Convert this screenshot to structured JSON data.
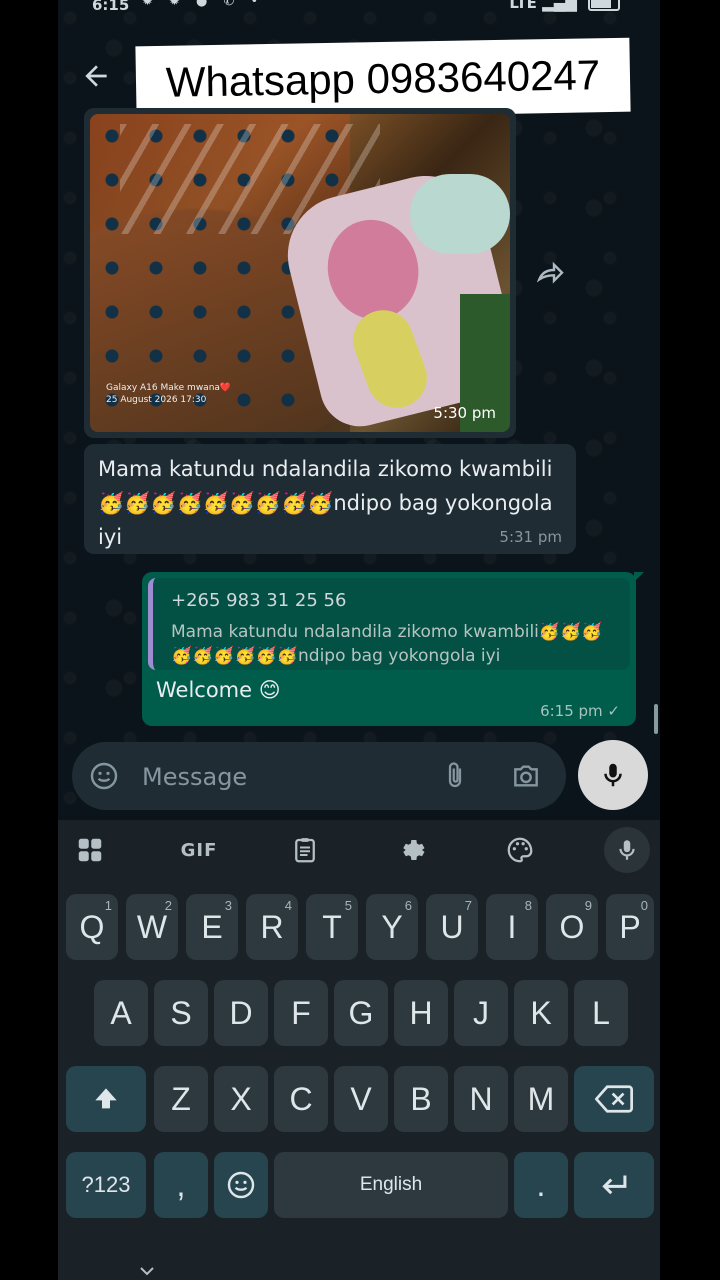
{
  "status_bar": {
    "time": "6:15",
    "notification_icons": "✹ ✹ ● ✆ •",
    "network": "LTE",
    "battery_icon": "battery-charging-icon"
  },
  "header": {
    "back_icon": "arrow-left-icon",
    "overlay_caption": "Whatsapp 0983640247"
  },
  "messages": [
    {
      "type": "image",
      "direction": "incoming",
      "watermark_line1": "Galaxy A16 Make mwana❤️",
      "watermark_line2": "25 August 2026 17:30",
      "time": "5:30 pm",
      "forward_icon": "forward-icon"
    },
    {
      "type": "text",
      "direction": "incoming",
      "text": "Mama katundu ndalandila zikomo kwambili🥳🥳🥳🥳🥳🥳🥳🥳🥳ndipo bag yokongola iyi",
      "time": "5:31 pm"
    },
    {
      "type": "reply",
      "direction": "outgoing",
      "quote_author": "+265 983 31 25 56",
      "quote_text": "Mama katundu ndalandila zikomo kwambili🥳🥳🥳🥳🥳🥳🥳🥳🥳ndipo bag yokongola iyi",
      "text": "Welcome 😊",
      "time": "6:15 pm ✓"
    }
  ],
  "composer": {
    "placeholder": "Message",
    "emoji_icon": "sticker-icon",
    "attach_icon": "paperclip-icon",
    "camera_icon": "camera-icon",
    "mic_icon": "microphone-icon"
  },
  "keyboard": {
    "toolbar": {
      "apps_icon": "grid-icon",
      "gif_label": "GIF",
      "clipboard_icon": "clipboard-icon",
      "settings_icon": "gear-icon",
      "theme_icon": "palette-icon",
      "voice_icon": "microphone-icon"
    },
    "row1": [
      {
        "key": "Q",
        "hint": "1"
      },
      {
        "key": "W",
        "hint": "2"
      },
      {
        "key": "E",
        "hint": "3"
      },
      {
        "key": "R",
        "hint": "4"
      },
      {
        "key": "T",
        "hint": "5"
      },
      {
        "key": "Y",
        "hint": "6"
      },
      {
        "key": "U",
        "hint": "7"
      },
      {
        "key": "I",
        "hint": "8"
      },
      {
        "key": "O",
        "hint": "9"
      },
      {
        "key": "P",
        "hint": "0"
      }
    ],
    "row2": [
      "A",
      "S",
      "D",
      "F",
      "G",
      "H",
      "J",
      "K",
      "L"
    ],
    "row3": [
      "Z",
      "X",
      "C",
      "V",
      "B",
      "N",
      "M"
    ],
    "shift_icon": "shift-icon",
    "backspace_icon": "backspace-icon",
    "symbols_label": "?123",
    "comma_label": ",",
    "emoji_key_icon": "emoji-icon",
    "space_label": "English",
    "period_label": ".",
    "enter_icon": "enter-icon",
    "nav_icon": "chevron-down-icon"
  }
}
